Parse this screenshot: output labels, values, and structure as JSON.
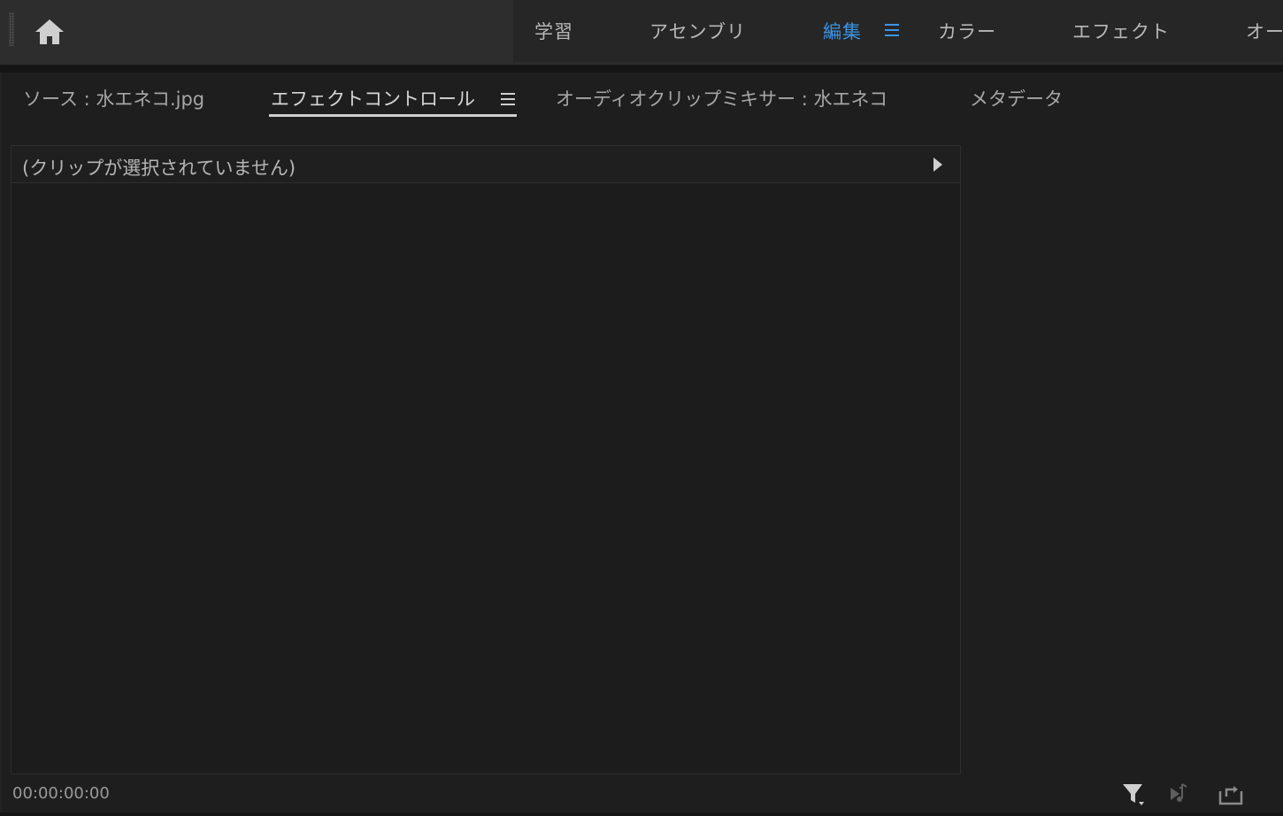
{
  "workspace_bar": {
    "home_icon": "home-icon",
    "tabs": [
      {
        "label": "学習"
      },
      {
        "label": "アセンブリ"
      },
      {
        "label": "編集"
      },
      {
        "label": "カラー"
      },
      {
        "label": "エフェクト"
      },
      {
        "label": "オー"
      }
    ],
    "active_tab": "編集",
    "menu_icon": "hamburger-menu-icon",
    "accent_color": "#3b94e6"
  },
  "panel": {
    "tabs": [
      {
        "label": "ソース : 水エネコ.jpg"
      },
      {
        "label": "エフェクトコントロール"
      },
      {
        "label": "オーディオクリップミキサー : 水エネコ"
      },
      {
        "label": "メタデータ"
      }
    ],
    "active_tab": "エフェクトコントロール",
    "menu_icon": "hamburger-menu-icon"
  },
  "effect_controls": {
    "no_clip_message": "(クリップが選択されていません)",
    "expand_icon": "play-triangle-icon",
    "timecode": "00:00:00:00",
    "bottom_icons": [
      "filter-icon",
      "play-audio-icon",
      "export-icon"
    ]
  }
}
